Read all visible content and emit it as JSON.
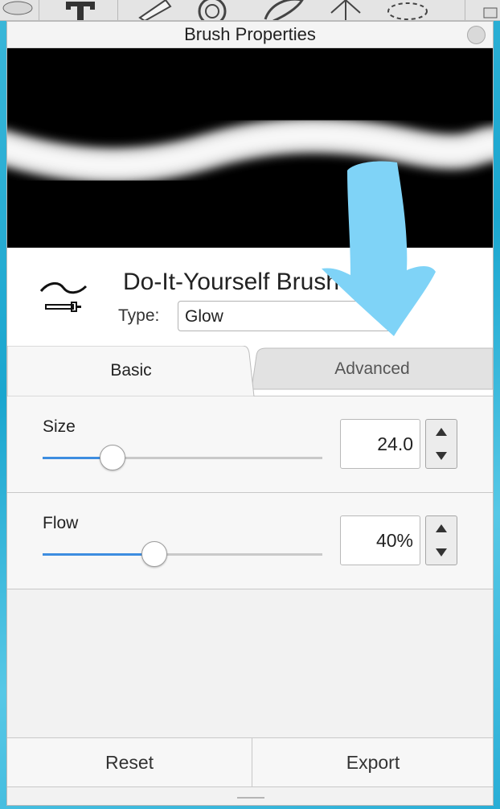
{
  "window": {
    "title": "Brush Properties"
  },
  "brush": {
    "name": "Do-It-Yourself Brush",
    "type_label": "Type:",
    "type_value": "Glow"
  },
  "tabs": [
    {
      "label": "Basic",
      "active": true
    },
    {
      "label": "Advanced",
      "active": false
    }
  ],
  "settings": {
    "size": {
      "label": "Size",
      "value": "24.0",
      "slider_fraction": 0.25
    },
    "flow": {
      "label": "Flow",
      "value": "40%",
      "slider_fraction": 0.4
    }
  },
  "footer": {
    "reset_label": "Reset",
    "export_label": "Export"
  },
  "colors": {
    "accent": "#3d8de0",
    "annotation_arrow": "#7fd3f7",
    "preview_background": "#000000"
  },
  "icons": {
    "brush": "brush-icon",
    "close": "close-icon",
    "step_up": "triangle-up-icon",
    "step_down": "triangle-down-icon"
  }
}
